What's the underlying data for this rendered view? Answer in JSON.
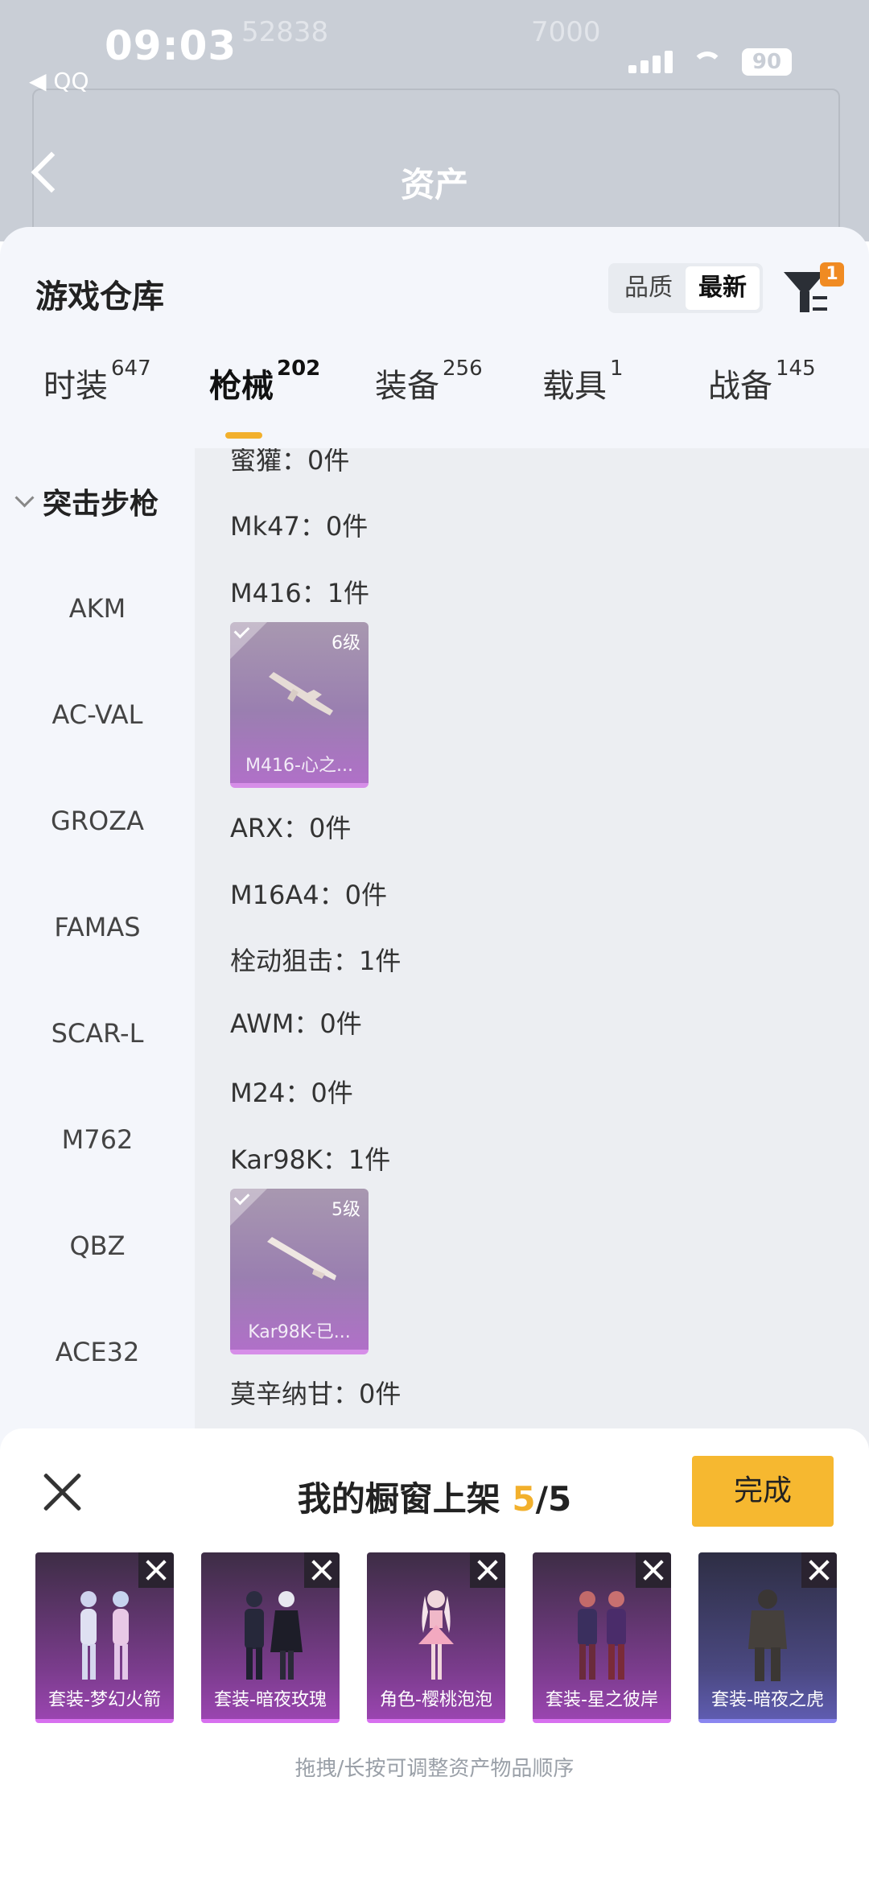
{
  "status_bar": {
    "time": "09:03",
    "back_label": "◀ QQ",
    "battery": "90"
  },
  "background_page": {
    "title": "资产",
    "faint_values": [
      "52838",
      "7000"
    ]
  },
  "sheet": {
    "title": "游戏仓库",
    "sort": [
      "品质",
      "最新"
    ],
    "filter_badge": "1"
  },
  "tabs": [
    {
      "label": "时装",
      "count": "647"
    },
    {
      "label": "枪械",
      "count": "202"
    },
    {
      "label": "装备",
      "count": "256"
    },
    {
      "label": "载具",
      "count": "1"
    },
    {
      "label": "战备",
      "count": "145"
    }
  ],
  "sidebar": {
    "header": "突击步枪",
    "items": [
      "AKM",
      "AC-VAL",
      "GROZA",
      "FAMAS",
      "SCAR-L",
      "M762",
      "QBZ",
      "ACE32"
    ]
  },
  "list": {
    "rows": [
      "蜜獾：0件",
      "Mk47：0件",
      "M416：1件",
      "ARX：0件",
      "M16A4：0件",
      "栓动狙击：1件",
      "AWM：0件",
      "M24：0件",
      "Kar98K：1件",
      "莫辛纳甘：0件"
    ],
    "cards": [
      {
        "level": "6级",
        "name": "M416-心之..."
      },
      {
        "level": "5级",
        "name": "Kar98K-已..."
      }
    ]
  },
  "panel": {
    "title_prefix": "我的橱窗上架",
    "count_current": "5",
    "count_total": "/5",
    "done_label": "完成",
    "items": [
      "套装-梦幻火箭",
      "套装-暗夜玫瑰",
      "角色-樱桃泡泡",
      "套装-星之彼岸",
      "套装-暗夜之虎"
    ],
    "hint": "拖拽/长按可调整资产物品顺序"
  }
}
